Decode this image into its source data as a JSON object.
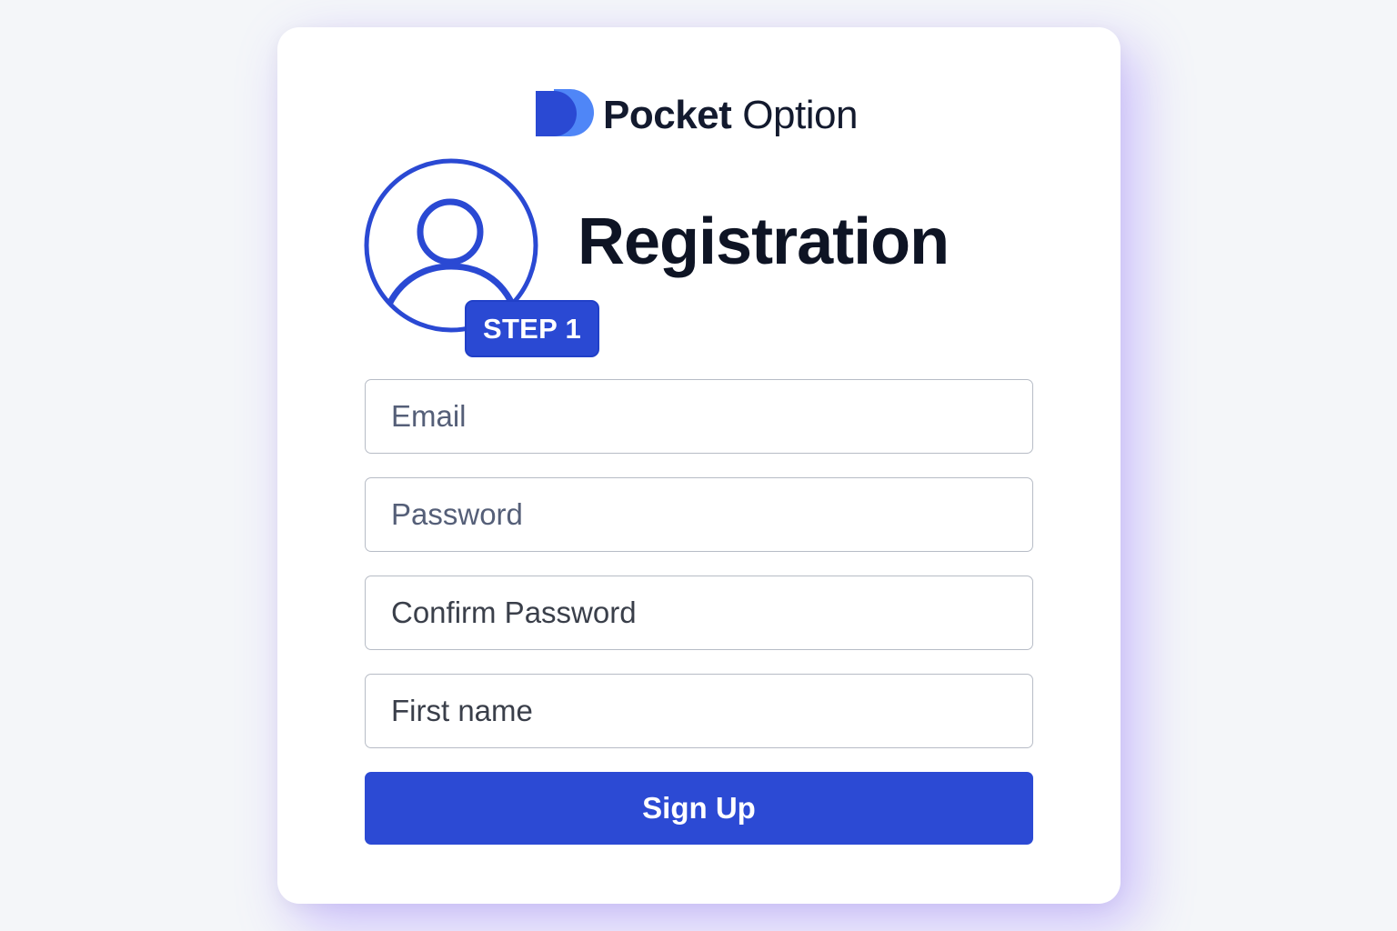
{
  "brand": {
    "name_bold": "Pocket",
    "name_light": "Option",
    "logo_icon": "pocket-option-logo-icon",
    "primary_color": "#2c4ad4",
    "secondary_color": "#4f86f7"
  },
  "header": {
    "title": "Registration",
    "step_badge": "STEP 1",
    "avatar_icon": "user-circle-icon"
  },
  "form": {
    "email_placeholder": "Email",
    "password_placeholder": "Password",
    "confirm_password_placeholder": "Confirm Password",
    "first_name_placeholder": "First name",
    "submit_label": "Sign Up"
  }
}
